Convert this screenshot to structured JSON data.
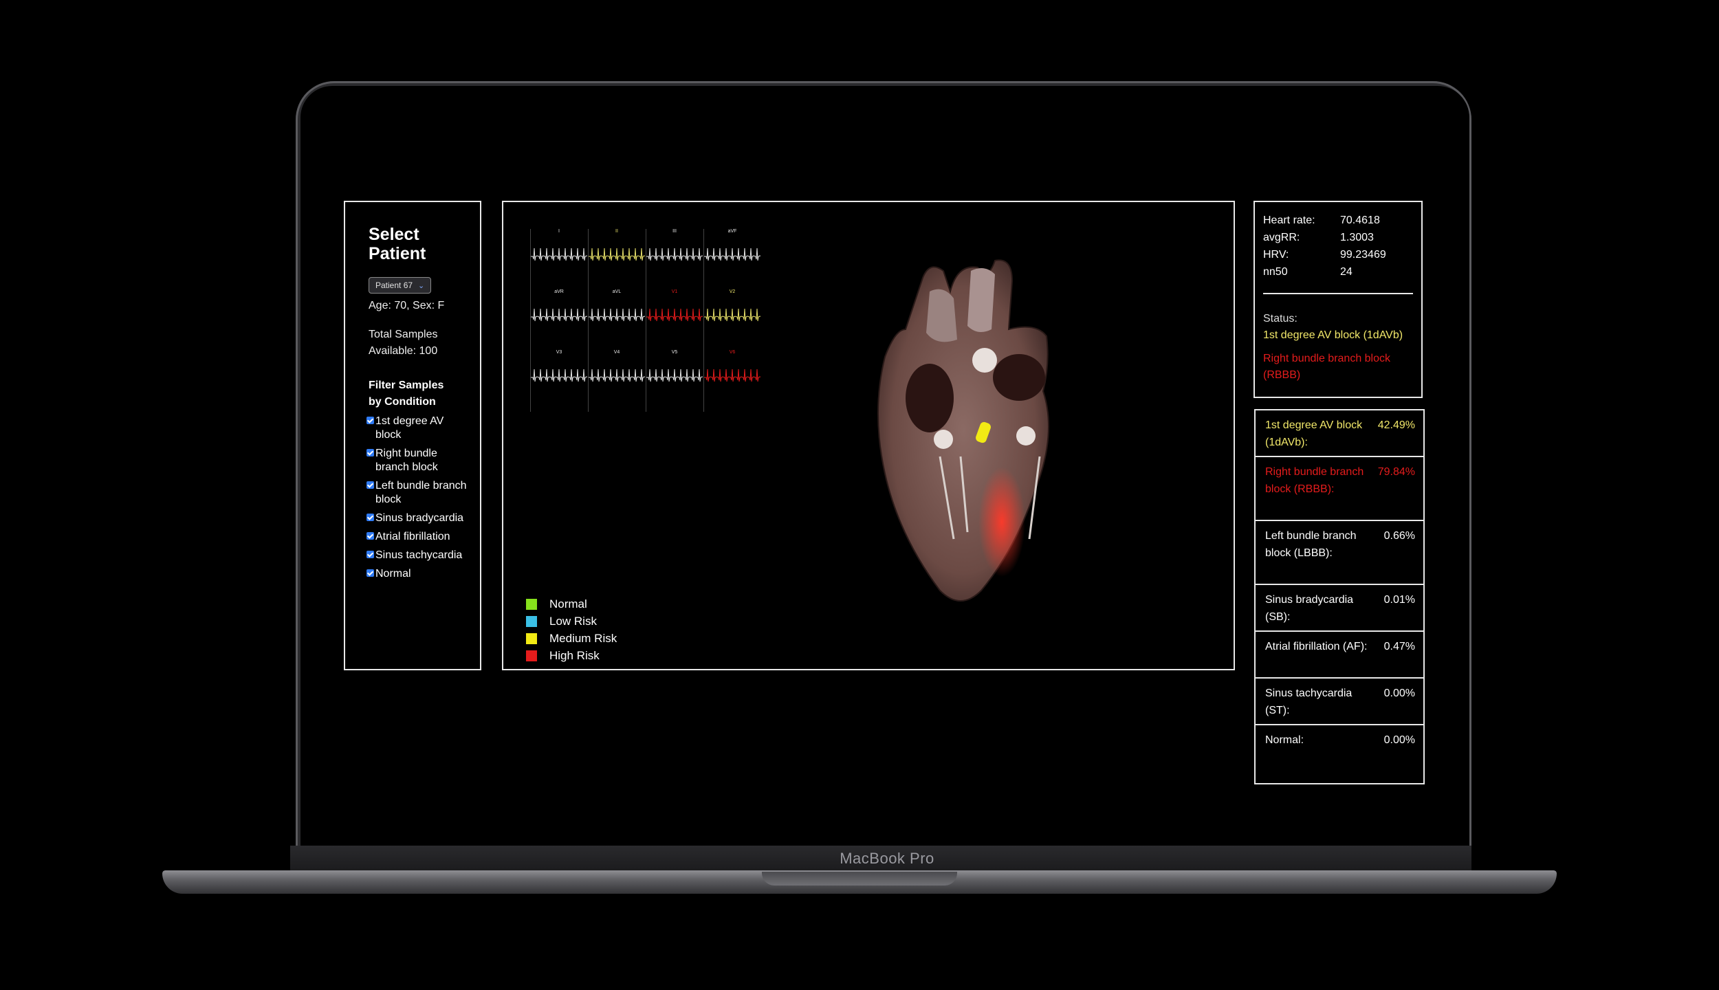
{
  "device": {
    "brand": "MacBook Pro"
  },
  "patient_panel": {
    "title": "Select Patient",
    "patient_select": "Patient 67",
    "age_sex": "Age: 70, Sex: F",
    "samples": "Total Samples Available: 100",
    "filter_heading": "Filter Samples by Condition",
    "conditions": [
      {
        "label": "1st degree AV block",
        "checked": true
      },
      {
        "label": "Right bundle branch block",
        "checked": true
      },
      {
        "label": "Left bundle branch block",
        "checked": true
      },
      {
        "label": "Sinus bradycardia",
        "checked": true
      },
      {
        "label": "Atrial fibrillation",
        "checked": true
      },
      {
        "label": "Sinus tachycardia",
        "checked": true
      },
      {
        "label": "Normal",
        "checked": true
      }
    ]
  },
  "ecg": {
    "leads": [
      {
        "name": "I",
        "color": "#e8e8e8"
      },
      {
        "name": "II",
        "color": "#e9e26a"
      },
      {
        "name": "III",
        "color": "#e8e8e8"
      },
      {
        "name": "aVF",
        "color": "#e8e8e8"
      },
      {
        "name": "aVR",
        "color": "#e8e8e8"
      },
      {
        "name": "aVL",
        "color": "#e8e8e8"
      },
      {
        "name": "V1",
        "color": "#e51c1c"
      },
      {
        "name": "V2",
        "color": "#e9e26a"
      },
      {
        "name": "V3",
        "color": "#e8e8e8"
      },
      {
        "name": "V4",
        "color": "#e8e8e8"
      },
      {
        "name": "V5",
        "color": "#e8e8e8"
      },
      {
        "name": "V6",
        "color": "#e51c1c"
      }
    ]
  },
  "legend": [
    {
      "label": "Normal",
      "color": "#86e01c"
    },
    {
      "label": "Low Risk",
      "color": "#3bc0e6"
    },
    {
      "label": "Medium Risk",
      "color": "#f2ea14"
    },
    {
      "label": "High Risk",
      "color": "#e51c1c"
    }
  ],
  "stats": [
    {
      "label": "Heart rate:",
      "value": "70.4618"
    },
    {
      "label": "avgRR:",
      "value": "1.3003"
    },
    {
      "label": "HRV:",
      "value": "99.23469"
    },
    {
      "label": "nn50",
      "value": "24"
    }
  ],
  "status": {
    "label": "Status:",
    "items": [
      {
        "text": "1st degree AV block (1dAVb)",
        "color": "#f2e86a"
      },
      {
        "text": "Right bundle branch block (RBBB)",
        "color": "#e51c1c"
      }
    ]
  },
  "probabilities": [
    {
      "label": "1st degree AV block (1dAVb):",
      "value": "42.49%",
      "color": "#f2e86a"
    },
    {
      "label": "Right bundle branch block (RBBB):",
      "value": "79.84%",
      "color": "#e51c1c"
    },
    {
      "label": "Left bundle branch block (LBBB):",
      "value": "0.66%",
      "color": "#ffffff"
    },
    {
      "label": "Sinus bradycardia (SB):",
      "value": "0.01%",
      "color": "#ffffff"
    },
    {
      "label": "Atrial fibrillation (AF):",
      "value": "0.47%",
      "color": "#ffffff"
    },
    {
      "label": "Sinus tachycardia (ST):",
      "value": "0.00%",
      "color": "#ffffff"
    },
    {
      "label": "Normal:",
      "value": "0.00%",
      "color": "#ffffff"
    }
  ]
}
